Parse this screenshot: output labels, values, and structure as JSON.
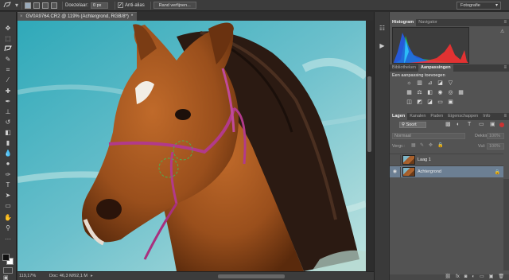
{
  "options_bar": {
    "feather_label": "Doezelaar:",
    "feather_value": "0 px",
    "antialias_label": "Anti-alias",
    "refine_button": "Rand verfijnen...",
    "workspace": "Fotografie"
  },
  "document": {
    "tab_title": "GV0A9764.CR2 @ 119% (Achtergrond, RGB/8*)",
    "tab_modified": "*"
  },
  "status_bar": {
    "zoom": "119,17%",
    "doc_info": "Doc: 46,3 M/92,1 M"
  },
  "panels": {
    "histogram_tabs": [
      "Histogram",
      "Navigator"
    ],
    "adjust_tabs": [
      "Bibliotheken",
      "Aanpassingen"
    ],
    "adjust_title": "Een aanpassing toevoegen",
    "layers_tabs": [
      "Lagen",
      "Kanalen",
      "Paden",
      "Eigenschappen",
      "Info"
    ]
  },
  "layers": {
    "filter_kind": "Soort",
    "blend_mode": "Normaal",
    "opacity_label": "Dekking:",
    "opacity_value": "100%",
    "lock_label": "Vergr.:",
    "fill_label": "Vul:",
    "fill_value": "100%",
    "items": [
      {
        "name": "Laag 1",
        "visible": false,
        "selected": false
      },
      {
        "name": "Achtergrond",
        "visible": true,
        "selected": true
      }
    ]
  },
  "colors": {
    "selected_layer": "#6c7f93",
    "panel_bg": "#535353",
    "app_bg": "#2b2b2b"
  }
}
